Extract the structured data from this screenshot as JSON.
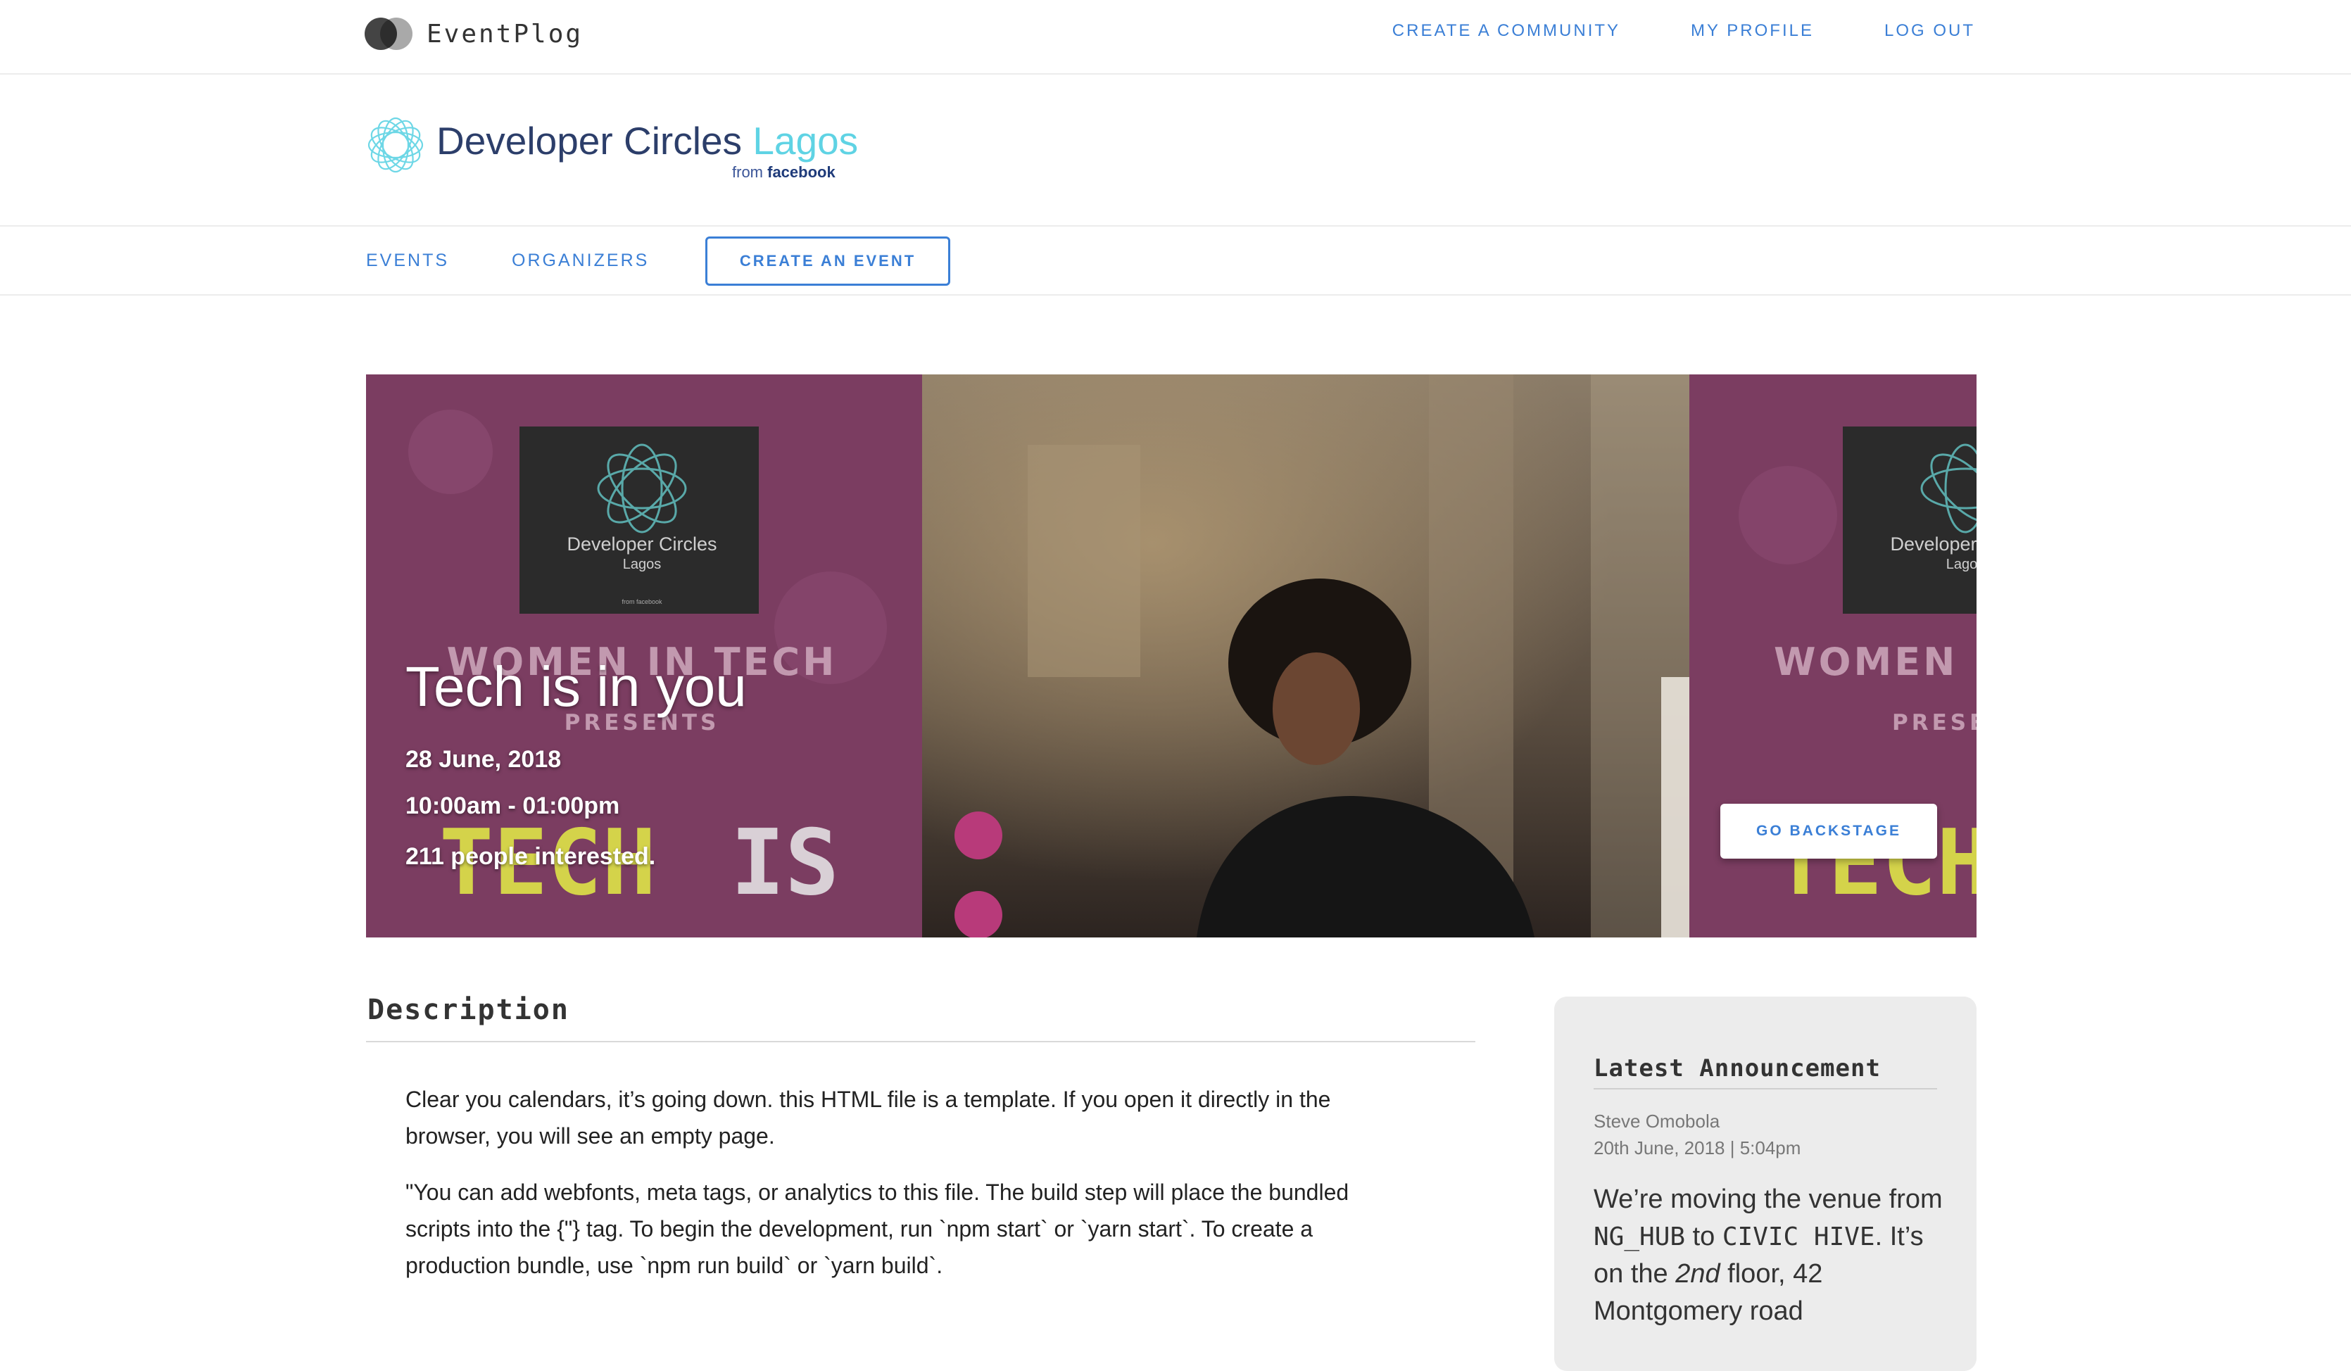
{
  "topbar": {
    "app_name": "EventPlog",
    "nav": [
      "CREATE A COMMUNITY",
      "MY PROFILE",
      "LOG OUT"
    ]
  },
  "community": {
    "name": "Developer Circles",
    "city": "Lagos",
    "from_label": "from",
    "from_brand": "facebook",
    "accent_color": "#5fd3e4"
  },
  "subnav": {
    "events": "EVENTS",
    "organizers": "ORGANIZERS",
    "create_event": "CREATE AN EVENT"
  },
  "hero": {
    "title": "Tech is in you",
    "date": "28 June, 2018",
    "time": "10:00am - 01:00pm",
    "interested": "211 people interested.",
    "backstage_button": "GO BACKSTAGE",
    "poster": {
      "logo_title": "Developer Circles",
      "logo_city": "Lagos",
      "logo_from": "from facebook",
      "headline": "WOMEN IN TECH",
      "presents": "PRESENTS",
      "tagline_a": "TECH",
      "tagline_b": "IS",
      "right_headline": "WOMEN I",
      "right_presents": "PRESE",
      "right_tagline": "TECH"
    },
    "poster_color": "#7b3d61"
  },
  "description": {
    "heading": "Description",
    "paragraphs": [
      "Clear you calendars, it’s going down. this HTML file is a template. If you open it directly in the browser, you will see an empty page.",
      "\"You can add webfonts, meta tags, or analytics to this file.  The build step will place the bundled scripts into the {\"} tag.  To begin the development, run `npm start` or `yarn start`.  To create a production bundle, use `npm run build` or `yarn build`."
    ]
  },
  "announcement": {
    "heading": "Latest Announcement",
    "author": "Steve Omobola",
    "date": "20th June, 2018 | 5:04pm",
    "message": {
      "part1": "We’re moving the venue from ",
      "code1": "NG_HUB",
      "part2": " to ",
      "code2": "CIVIC HIVE",
      "part3": ". It’s on the ",
      "emph": "2nd",
      "part4": " floor, 42 Montgomery road"
    }
  },
  "colors": {
    "link_blue": "#3b7fd6",
    "card_bg": "#ececec"
  }
}
